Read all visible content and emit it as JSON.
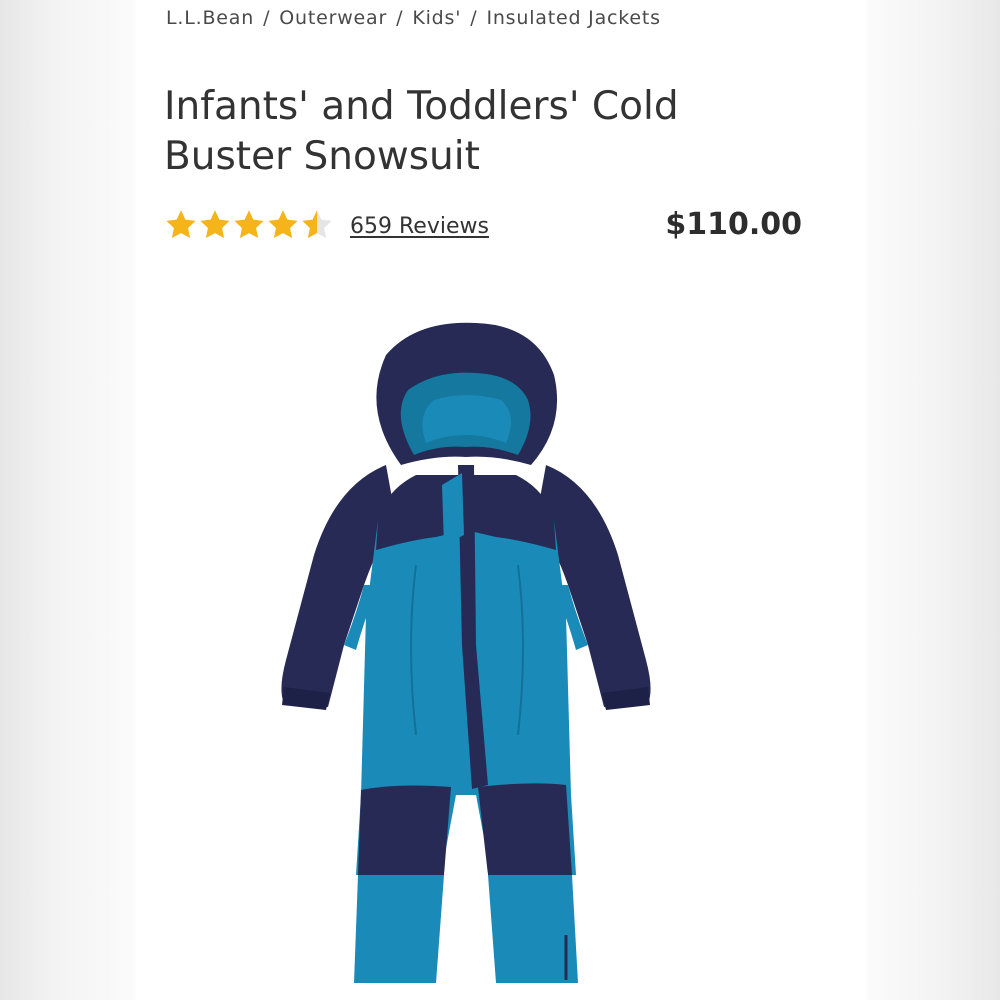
{
  "breadcrumb": {
    "items": [
      "L.L.Bean",
      "Outerwear",
      "Kids'",
      "Insulated Jackets"
    ],
    "separator": "/"
  },
  "product": {
    "title": "Infants' and Toddlers' Cold Buster Snowsuit",
    "rating": 4.5,
    "rating_max": 5,
    "reviews_label": "659 Reviews",
    "price": "$110.00",
    "image": {
      "alt": "Blue and navy one-piece hooded snowsuit",
      "primary_color": "#1a8bb8",
      "secondary_color": "#262a55"
    }
  },
  "colors": {
    "star": "#f4b41a",
    "text": "#333333"
  }
}
